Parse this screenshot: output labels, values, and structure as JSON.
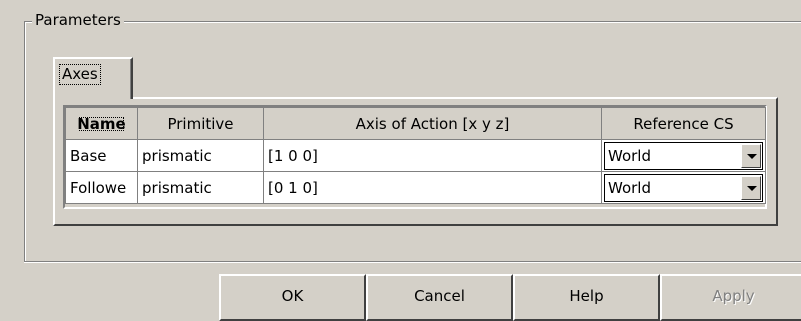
{
  "groupbox": {
    "title": "Parameters"
  },
  "tabs": [
    {
      "label": "Axes"
    }
  ],
  "table": {
    "headers": [
      "Name",
      "Primitive",
      "Axis of Action [x y z]",
      "Reference CS"
    ],
    "rows": [
      {
        "name": "Base",
        "primitive": "prismatic",
        "axis": "[1 0 0]",
        "reference_cs": "World"
      },
      {
        "name": "Followe",
        "primitive": "prismatic",
        "axis": "[0 1 0]",
        "reference_cs": "World"
      }
    ]
  },
  "buttons": {
    "ok": "OK",
    "cancel": "Cancel",
    "help": "Help",
    "apply": "Apply"
  },
  "icons": {
    "dropdown": "chevron-down-icon"
  }
}
